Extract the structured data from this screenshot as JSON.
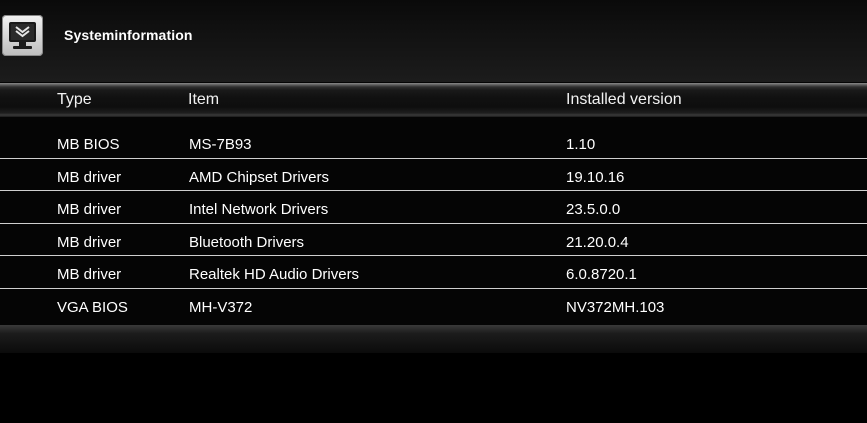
{
  "header": {
    "title": "Systeminformation",
    "icon": "system-monitor-icon"
  },
  "columns": {
    "type": "Type",
    "item": "Item",
    "version": "Installed version"
  },
  "rows": [
    {
      "type": "MB BIOS",
      "item": "MS-7B93",
      "version": "1.10"
    },
    {
      "type": "MB driver",
      "item": "AMD Chipset Drivers",
      "version": "19.10.16"
    },
    {
      "type": "MB driver",
      "item": "Intel Network Drivers",
      "version": "23.5.0.0"
    },
    {
      "type": "MB driver",
      "item": "Bluetooth Drivers",
      "version": "21.20.0.4"
    },
    {
      "type": "MB driver",
      "item": "Realtek HD Audio Drivers",
      "version": "6.0.8720.1"
    },
    {
      "type": "VGA BIOS",
      "item": "MH-V372",
      "version": "NV372MH.103"
    }
  ]
}
